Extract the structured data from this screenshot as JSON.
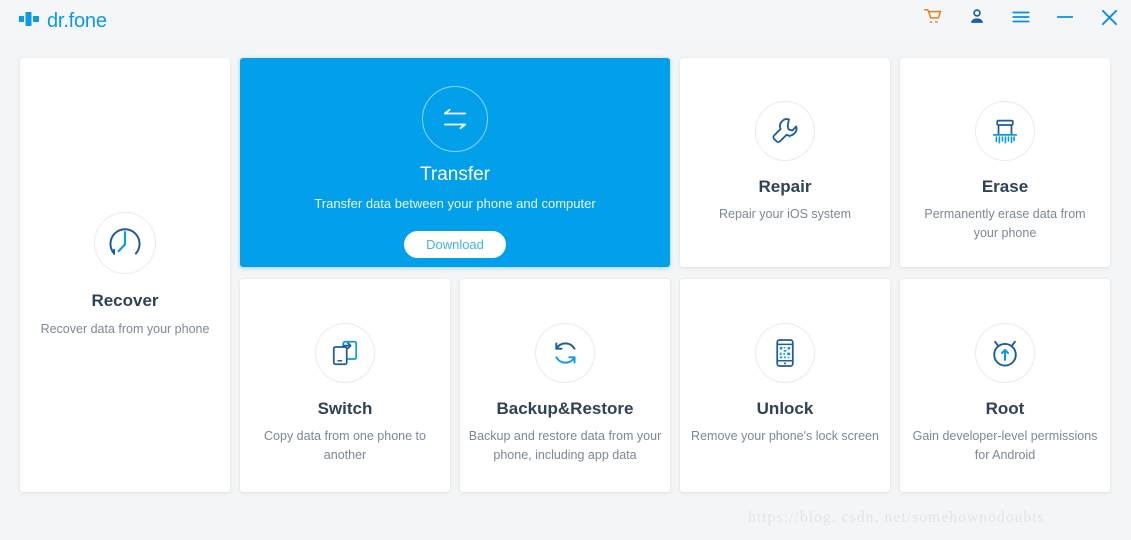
{
  "window": {
    "brand": "dr.fone",
    "logo_icon": "plus-cross-logo-icon",
    "actions": [
      {
        "name": "cart-icon",
        "label": "Cart",
        "color": "#e8821e"
      },
      {
        "name": "account-icon",
        "label": "Account",
        "color": "#1a5fa8"
      },
      {
        "name": "menu-icon",
        "label": "Menu",
        "color": "#0c8ee0"
      },
      {
        "name": "minimize-icon",
        "label": "Minimize",
        "color": "#0c8ee0"
      },
      {
        "name": "close-icon",
        "label": "Close",
        "color": "#0c8ee0"
      }
    ]
  },
  "colors": {
    "accent_blue": "#02a0ea",
    "icon_dark_blue": "#1d5b9b",
    "icon_light_blue": "#0c9ae4",
    "title_text": "#2f4257",
    "desc_text": "#7c8894",
    "page_bg": "#f4f5f6",
    "cart_orange": "#e8821e"
  },
  "cards": {
    "recover": {
      "title": "Recover",
      "desc": "Recover data from your phone",
      "icon": "clock-recover-icon"
    },
    "transfer": {
      "title": "Transfer",
      "desc": "Transfer data between your phone and computer",
      "icon": "two-way-arrows-icon",
      "button": "Download",
      "selected": true
    },
    "repair": {
      "title": "Repair",
      "desc": "Repair your iOS system",
      "icon": "wrench-icon"
    },
    "erase": {
      "title": "Erase",
      "desc": "Permanently erase data from your phone",
      "icon": "shredder-icon"
    },
    "switch": {
      "title": "Switch",
      "desc": "Copy data from one phone to another",
      "icon": "two-phones-transfer-icon"
    },
    "backup": {
      "title": "Backup&Restore",
      "desc": "Backup and restore data from your phone, including app data",
      "icon": "circular-refresh-icon"
    },
    "unlock": {
      "title": "Unlock",
      "desc": "Remove your phone's lock screen",
      "icon": "phone-lock-pattern-icon"
    },
    "root": {
      "title": "Root",
      "desc": "Gain developer-level permissions for Android",
      "icon": "android-root-icon"
    }
  },
  "watermark": "https://blog. csdn. net/somehownodoubts"
}
